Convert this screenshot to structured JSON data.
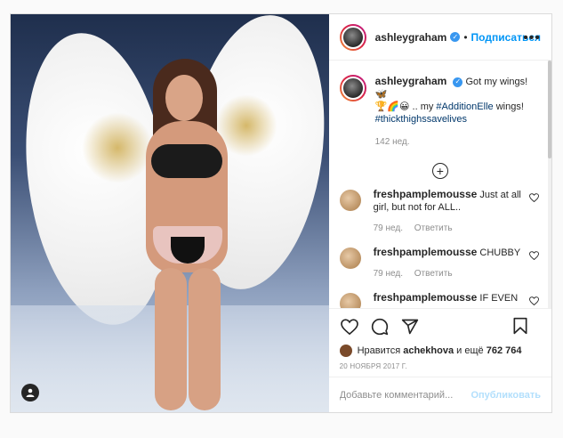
{
  "header": {
    "username": "ashleygraham",
    "verified_glyph": "✓",
    "separator": "•",
    "follow_label": "Подписаться",
    "more_glyph": "•••"
  },
  "caption": {
    "username": "ashleygraham",
    "text_1": "Got my wings! 🦋",
    "text_2": "🏆🌈😀 .. my",
    "hashtag_1": "#AdditionElle",
    "text_3": "wings!",
    "hashtag_2": "#thickthighssavelives",
    "time": "142 нед."
  },
  "load_more_glyph": "+",
  "comments": [
    {
      "username": "freshpamplemousse",
      "text": "Just at all girl, but not for ALL..",
      "time": "79 нед.",
      "reply": "Ответить"
    },
    {
      "username": "freshpamplemousse",
      "text": "CHUBBY",
      "time": "79 нед.",
      "reply": "Ответить"
    },
    {
      "username": "freshpamplemousse",
      "text": "IF EVEN",
      "time": "",
      "reply": ""
    }
  ],
  "likes": {
    "prefix": "Нравится",
    "user": "achekhova",
    "middle": "и ещё",
    "count": "762 764"
  },
  "date": "20 НОЯБРЯ 2017 Г.",
  "add_comment": {
    "placeholder": "Добавьте комментарий...",
    "publish_label": "Опубликовать"
  },
  "colors": {
    "accent": "#0095f6",
    "publish_disabled": "#b2dffc",
    "hashtag": "#00376b",
    "muted": "#8e8e8e"
  },
  "icons": [
    "heart-icon",
    "comment-icon",
    "share-icon",
    "bookmark-icon",
    "plus-circle-icon",
    "user-tag-icon",
    "verified-icon",
    "more-icon"
  ]
}
